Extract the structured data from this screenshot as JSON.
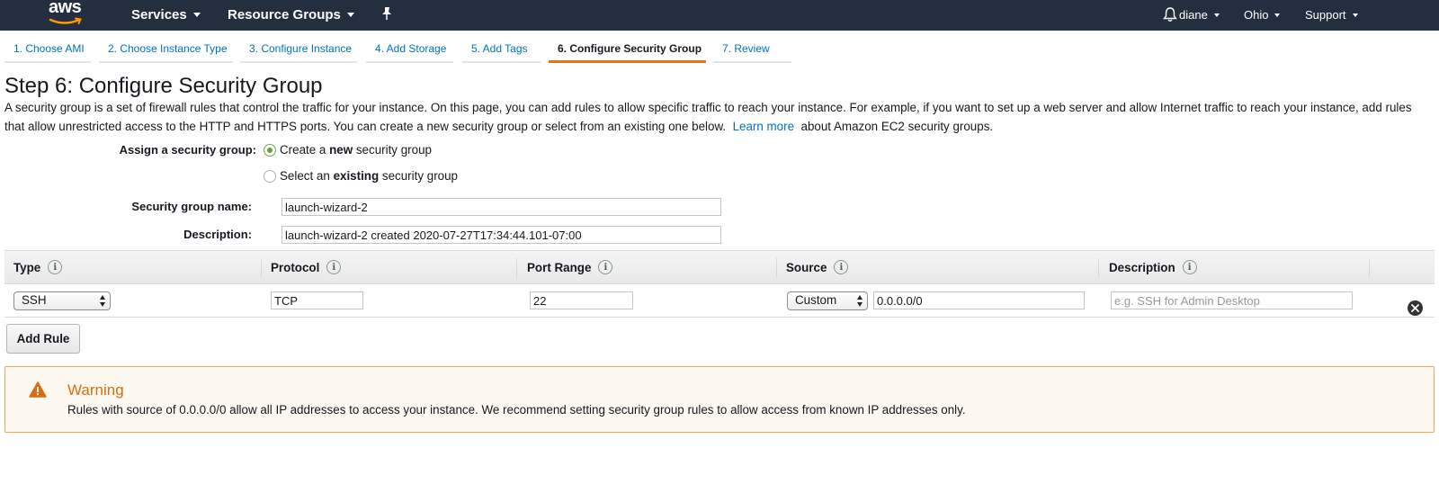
{
  "nav": {
    "logo_text": "aws",
    "services": "Services",
    "resource_groups": "Resource Groups",
    "user": "diane",
    "region": "Ohio",
    "support": "Support"
  },
  "tabs": [
    {
      "label": "1. Choose AMI"
    },
    {
      "label": "2. Choose Instance Type"
    },
    {
      "label": "3. Configure Instance"
    },
    {
      "label": "4. Add Storage"
    },
    {
      "label": "5. Add Tags"
    },
    {
      "label": "6. Configure Security Group",
      "active": true
    },
    {
      "label": "7. Review"
    }
  ],
  "page": {
    "title": "Step 6: Configure Security Group",
    "intro": "A security group is a set of firewall rules that control the traffic for your instance. On this page, you can add rules to allow specific traffic to reach your instance. For example, if you want to set up a web server and allow Internet traffic to reach your instance, add rules that allow unrestricted access to the HTTP and HTTPS ports. You can create a new security group or select from an existing one below.",
    "learn_more": "Learn more",
    "intro_tail": "about Amazon EC2 security groups."
  },
  "assign": {
    "label": "Assign a security group:",
    "option_new_pre": "Create a ",
    "option_new_bold": "new",
    "option_new_post": " security group",
    "option_existing_pre": "Select an ",
    "option_existing_bold": "existing",
    "option_existing_post": " security group",
    "selected": "new"
  },
  "form": {
    "name_label": "Security group name:",
    "name_value": "launch-wizard-2",
    "desc_label": "Description:",
    "desc_value": "launch-wizard-2 created 2020-07-27T17:34:44.101-07:00"
  },
  "rules_table": {
    "columns": [
      "Type",
      "Protocol",
      "Port Range",
      "Source",
      "Description"
    ],
    "rows": [
      {
        "type": "SSH",
        "protocol": "TCP",
        "port_range": "22",
        "source_mode": "Custom",
        "source_cidr": "0.0.0.0/0",
        "description_placeholder": "e.g. SSH for Admin Desktop"
      }
    ]
  },
  "add_rule_label": "Add Rule",
  "warning": {
    "title": "Warning",
    "text": "Rules with source of 0.0.0.0/0 allow all IP addresses to access your instance. We recommend setting security group rules to allow access from known IP addresses only."
  },
  "colors": {
    "nav_bg": "#232f3e",
    "link": "#0073bb",
    "active_tab": "#ec7211",
    "warning": "#dd6b10"
  }
}
